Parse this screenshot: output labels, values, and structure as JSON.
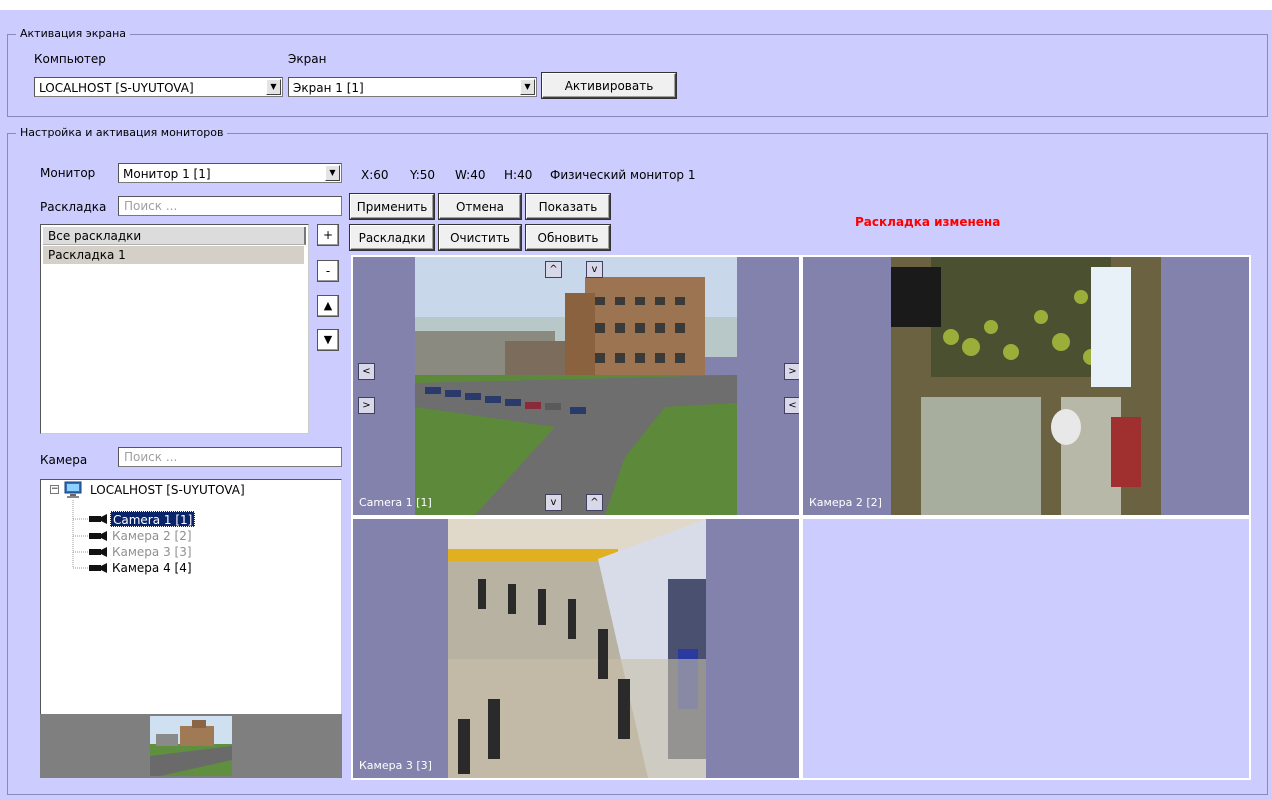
{
  "screen_activation": {
    "title": "Активация экрана",
    "computer_label": "Компьютер",
    "computer_value": "LOCALHOST [S-UYUTOVA]",
    "screen_label": "Экран",
    "screen_value": "Экран 1 [1]",
    "activate_button": "Активировать"
  },
  "monitors": {
    "title": "Настройка и активация мониторов",
    "monitor_label": "Монитор",
    "monitor_value": "Монитор 1 [1]",
    "layout_label": "Раскладка",
    "layout_search_placeholder": "Поиск ...",
    "layouts": [
      "Все раскладки",
      "Раскладка 1"
    ],
    "add_btn": "+",
    "remove_btn": "-",
    "up_btn": "▲",
    "down_btn": "▼",
    "camera_label": "Камера",
    "camera_search_placeholder": "Поиск ...",
    "tree": {
      "host": "LOCALHOST [S-UYUTOVA]",
      "cameras": [
        "Camera 1 [1]",
        "Камера 2 [2]",
        "Камера 3 [3]",
        "Камера 4 [4]"
      ]
    }
  },
  "geometry_status": {
    "x": "X:60",
    "y": "Y:50",
    "w": "W:40",
    "h": "H:40",
    "physical": "Физический монитор 1"
  },
  "buttons": {
    "apply": "Применить",
    "cancel": "Отмена",
    "show": "Показать",
    "layouts": "Раскладки",
    "clear": "Очистить",
    "refresh": "Обновить"
  },
  "layout_changed": "Раскладка изменена",
  "grid": {
    "cells": [
      "Camera 1 [1]",
      "Камера 2 [2]",
      "Камера 3 [3]"
    ]
  },
  "nav": {
    "up": "^",
    "down": "v",
    "left": "<",
    "right": ">"
  },
  "colors": {
    "background": "#ccccff",
    "cell": "#8282ad",
    "alert": "#ff0000",
    "selection": "#0a246a"
  }
}
